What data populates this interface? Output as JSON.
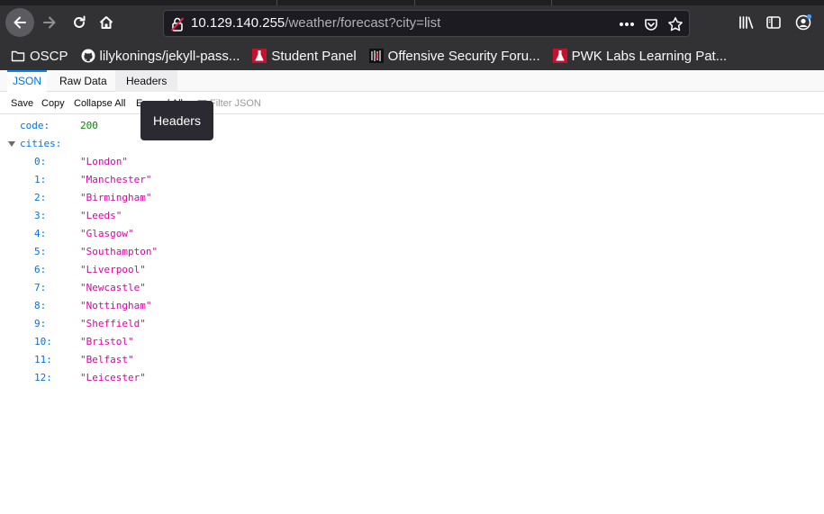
{
  "browser": {
    "url_host": "10.129.140.255",
    "url_path": "/weather/forecast?city=list"
  },
  "bookmarks": [
    {
      "label": "OSCP",
      "icon": "folder-icon"
    },
    {
      "label": "lilykonings/jekyll-pass...",
      "icon": "github-icon"
    },
    {
      "label": "Student Panel",
      "icon": "offsec-flask-icon"
    },
    {
      "label": "Offensive Security Foru...",
      "icon": "offsec-forum-icon"
    },
    {
      "label": "PWK Labs Learning Pat...",
      "icon": "offsec-flask-icon"
    }
  ],
  "viewer": {
    "tabs": [
      {
        "label": "JSON",
        "state": "active"
      },
      {
        "label": "Raw Data",
        "state": "normal"
      },
      {
        "label": "Headers",
        "state": "hovered"
      }
    ],
    "toolbar": {
      "save": "Save",
      "copy": "Copy",
      "collapse_all": "Collapse All",
      "expand_all": "Expand All",
      "filter_placeholder": "Filter JSON"
    },
    "tooltip": "Headers"
  },
  "json": {
    "code_key": "code:",
    "code_value": "200",
    "cities_key": "cities:",
    "cities": [
      {
        "index": "0:",
        "value": "\"London\""
      },
      {
        "index": "1:",
        "value": "\"Manchester\""
      },
      {
        "index": "2:",
        "value": "\"Birmingham\""
      },
      {
        "index": "3:",
        "value": "\"Leeds\""
      },
      {
        "index": "4:",
        "value": "\"Glasgow\""
      },
      {
        "index": "5:",
        "value": "\"Southampton\""
      },
      {
        "index": "6:",
        "value": "\"Liverpool\""
      },
      {
        "index": "7:",
        "value": "\"Newcastle\""
      },
      {
        "index": "8:",
        "value": "\"Nottingham\""
      },
      {
        "index": "9:",
        "value": "\"Sheffield\""
      },
      {
        "index": "10:",
        "value": "\"Bristol\""
      },
      {
        "index": "11:",
        "value": "\"Belfast\""
      },
      {
        "index": "12:",
        "value": "\"Leicester\""
      }
    ]
  },
  "colors": {
    "key": "#0074e8",
    "string": "#dd00a9",
    "number": "#058b00",
    "active_tab": "#0a84ff"
  }
}
